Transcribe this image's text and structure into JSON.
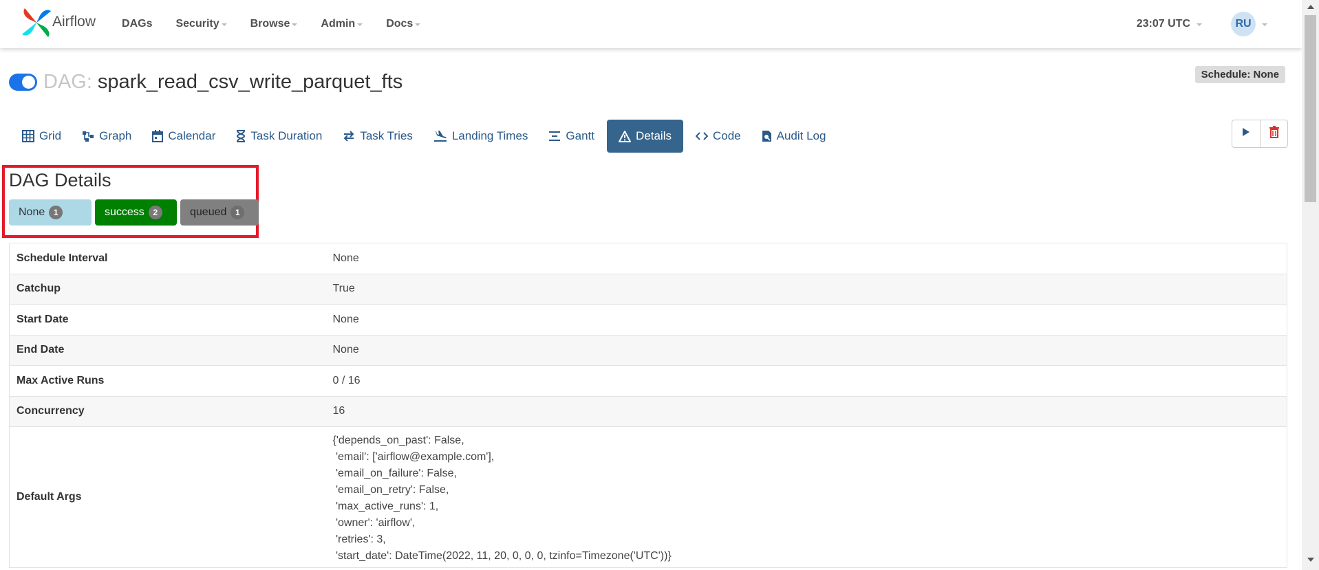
{
  "brand": {
    "name": "Airflow"
  },
  "nav": {
    "items": [
      {
        "label": "DAGs",
        "dropdown": false
      },
      {
        "label": "Security",
        "dropdown": true
      },
      {
        "label": "Browse",
        "dropdown": true
      },
      {
        "label": "Admin",
        "dropdown": true
      },
      {
        "label": "Docs",
        "dropdown": true
      }
    ],
    "clock": "23:07 UTC",
    "user_initials": "RU"
  },
  "dag": {
    "toggle_on": true,
    "label": "DAG:",
    "id": "spark_read_csv_write_parquet_fts",
    "schedule_badge": "Schedule: None"
  },
  "tabs": [
    {
      "label": "Grid",
      "icon": "grid-icon",
      "active": false
    },
    {
      "label": "Graph",
      "icon": "graph-icon",
      "active": false
    },
    {
      "label": "Calendar",
      "icon": "calendar-icon",
      "active": false
    },
    {
      "label": "Task Duration",
      "icon": "hourglass-icon",
      "active": false
    },
    {
      "label": "Task Tries",
      "icon": "retry-icon",
      "active": false
    },
    {
      "label": "Landing Times",
      "icon": "plane-landing-icon",
      "active": false
    },
    {
      "label": "Gantt",
      "icon": "gantt-icon",
      "active": false
    },
    {
      "label": "Details",
      "icon": "warning-icon",
      "active": true
    },
    {
      "label": "Code",
      "icon": "code-icon",
      "active": false
    },
    {
      "label": "Audit Log",
      "icon": "audit-log-icon",
      "active": false
    }
  ],
  "actions": {
    "trigger_icon": "play-icon",
    "delete_icon": "trash-icon"
  },
  "details": {
    "title": "DAG Details",
    "states": [
      {
        "label": "None",
        "count": "1"
      },
      {
        "label": "success",
        "count": "2"
      },
      {
        "label": "queued",
        "count": "1"
      }
    ],
    "rows": [
      {
        "key": "Schedule Interval",
        "value": "None"
      },
      {
        "key": "Catchup",
        "value": "True"
      },
      {
        "key": "Start Date",
        "value": "None"
      },
      {
        "key": "End Date",
        "value": "None"
      },
      {
        "key": "Max Active Runs",
        "value": "0 / 16"
      },
      {
        "key": "Concurrency",
        "value": "16"
      }
    ],
    "default_args": {
      "key": "Default Args",
      "lines": [
        "{'depends_on_past': False,",
        " 'email': ['airflow@example.com'],",
        " 'email_on_failure': False,",
        " 'email_on_retry': False,",
        " 'max_active_runs': 1,",
        " 'owner': 'airflow',",
        " 'retries': 3,",
        " 'start_date': DateTime(2022, 11, 20, 0, 0, 0, tzinfo=Timezone('UTC'))}"
      ]
    }
  },
  "colors": {
    "accent": "#35648c",
    "toggle": "#1a73e8",
    "highlight": "#e21b2a",
    "state_none": "#add8e6",
    "state_success": "#008000",
    "state_queued": "#808080"
  }
}
